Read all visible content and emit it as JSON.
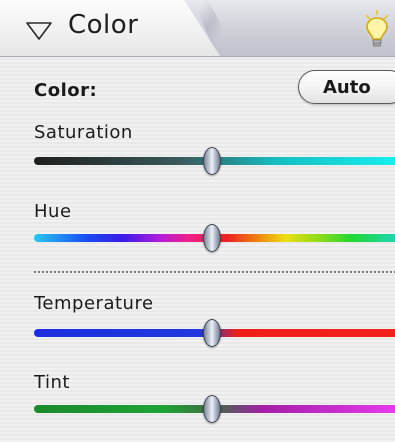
{
  "header": {
    "title": "Color",
    "disclosure_icon": "disclosure-triangle-down-icon",
    "tip_icon": "lightbulb-icon"
  },
  "color_row": {
    "label": "Color:",
    "auto_button_label": "Auto"
  },
  "sliders": [
    {
      "label": "Saturation",
      "value": 0.48,
      "gradient": "linear-gradient(90deg, #1e1e1e 0%, #3a5a5c 40%, #16bdbf 65%, #19f0f2 100%)"
    },
    {
      "label": "Hue",
      "value": 0.48,
      "gradient": "linear-gradient(90deg, #27c9f1 0%, #1a4ff0 14%, #3b1be9 24%, #b21ddb 34%, #f01f8a 42%, #ee1f23 52%, #f07d12 60%, #eede14 68%, #82db17 78%, #20d834 86%, #1ed6c8 100%)"
    },
    {
      "label": "Temperature",
      "value": 0.48,
      "gradient": "linear-gradient(90deg, #1c2fe0 0%, #2038df 45%, #ef1f16 55%, #f2221b 100%)"
    },
    {
      "label": "Tint",
      "value": 0.48,
      "gradient": "linear-gradient(90deg, #1b8a2c 0%, #1ea336 35%, #3c7040 48%, #a41ea8 62%, #ea3cf0 100%)"
    }
  ],
  "colors": {
    "thumb": "#c9d0dc",
    "divider": "#7a7a7a"
  }
}
